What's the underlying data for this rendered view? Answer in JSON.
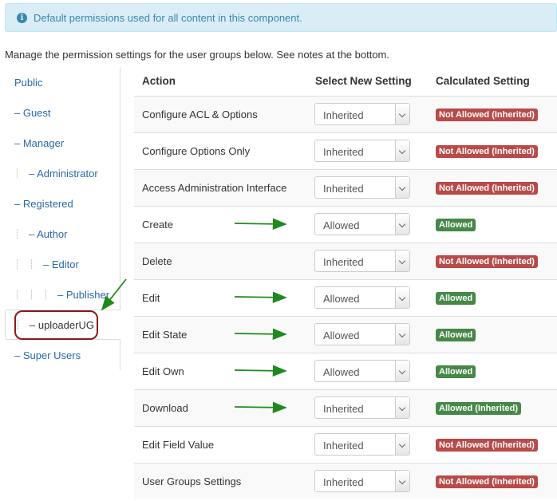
{
  "alert": {
    "icon": "info-icon",
    "text": "Default permissions used for all content in this component."
  },
  "intro": "Manage the permission settings for the user groups below. See notes at the bottom.",
  "groups": [
    {
      "label": "Public",
      "depth": 0
    },
    {
      "label": "– Guest",
      "depth": 0
    },
    {
      "label": "– Manager",
      "depth": 0
    },
    {
      "label": "– Administrator",
      "depth": 1
    },
    {
      "label": "– Registered",
      "depth": 0
    },
    {
      "label": "– Author",
      "depth": 1
    },
    {
      "label": "– Editor",
      "depth": 2
    },
    {
      "label": "– Publisher",
      "depth": 3
    },
    {
      "label": "– uploaderUG",
      "depth": 1,
      "active": true
    },
    {
      "label": "– Super Users",
      "depth": 0
    }
  ],
  "table": {
    "headers": {
      "action": "Action",
      "select": "Select New Setting",
      "calculated": "Calculated Setting"
    },
    "rows": [
      {
        "action": "Configure ACL & Options",
        "setting": "Inherited",
        "calculated": "Not Allowed (Inherited)",
        "status": "denied",
        "arrow": false
      },
      {
        "action": "Configure Options Only",
        "setting": "Inherited",
        "calculated": "Not Allowed (Inherited)",
        "status": "denied",
        "arrow": false
      },
      {
        "action": "Access Administration Interface",
        "setting": "Inherited",
        "calculated": "Not Allowed (Inherited)",
        "status": "denied",
        "arrow": false
      },
      {
        "action": "Create",
        "setting": "Allowed",
        "calculated": "Allowed",
        "status": "allowed",
        "arrow": true
      },
      {
        "action": "Delete",
        "setting": "Inherited",
        "calculated": "Not Allowed (Inherited)",
        "status": "denied",
        "arrow": false
      },
      {
        "action": "Edit",
        "setting": "Allowed",
        "calculated": "Allowed",
        "status": "allowed",
        "arrow": true
      },
      {
        "action": "Edit State",
        "setting": "Allowed",
        "calculated": "Allowed",
        "status": "allowed",
        "arrow": true
      },
      {
        "action": "Edit Own",
        "setting": "Allowed",
        "calculated": "Allowed",
        "status": "allowed",
        "arrow": true
      },
      {
        "action": "Download",
        "setting": "Inherited",
        "calculated": "Allowed (Inherited)",
        "status": "allowed",
        "arrow": true
      },
      {
        "action": "Edit Field Value",
        "setting": "Inherited",
        "calculated": "Not Allowed (Inherited)",
        "status": "denied",
        "arrow": false
      },
      {
        "action": "User Groups Settings",
        "setting": "Inherited",
        "calculated": "Not Allowed (Inherited)",
        "status": "denied",
        "arrow": false
      }
    ]
  },
  "colors": {
    "allowed": "#468847",
    "denied": "#b94a48",
    "link": "#2a69a8",
    "annotation_arrow": "#1e8a1e",
    "annotation_circle": "#8b1a1a"
  }
}
